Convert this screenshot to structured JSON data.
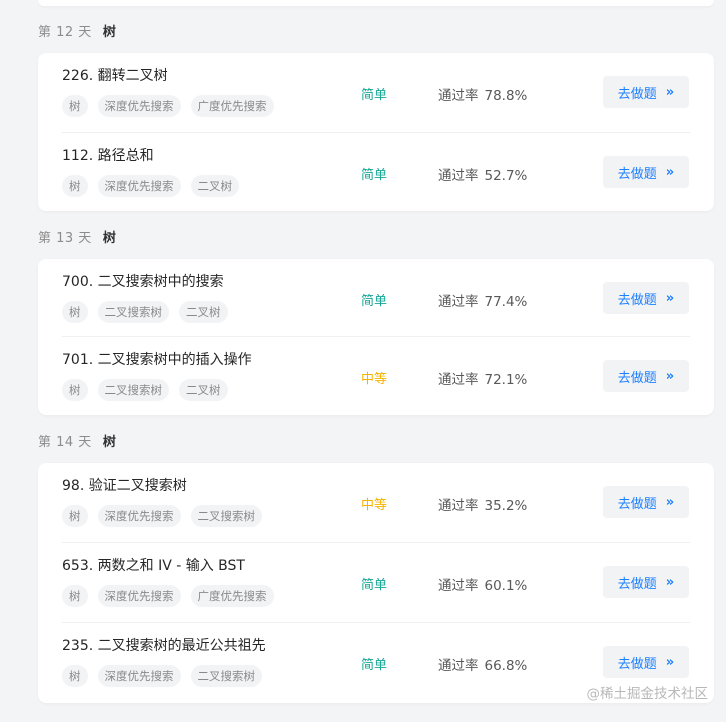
{
  "days": [
    {
      "day_label": "第 12 天",
      "topic": "树",
      "problems": [
        {
          "title": "226. 翻转二叉树",
          "tags": [
            "树",
            "深度优先搜索",
            "广度优先搜索"
          ],
          "difficulty": "简单",
          "difficulty_level": "easy",
          "rate_label": "通过率",
          "rate": "78.8%",
          "button_label": "去做题"
        },
        {
          "title": "112. 路径总和",
          "tags": [
            "树",
            "深度优先搜索",
            "二叉树"
          ],
          "difficulty": "简单",
          "difficulty_level": "easy",
          "rate_label": "通过率",
          "rate": "52.7%",
          "button_label": "去做题"
        }
      ]
    },
    {
      "day_label": "第 13 天",
      "topic": "树",
      "problems": [
        {
          "title": "700. 二叉搜索树中的搜索",
          "tags": [
            "树",
            "二叉搜索树",
            "二叉树"
          ],
          "difficulty": "简单",
          "difficulty_level": "easy",
          "rate_label": "通过率",
          "rate": "77.4%",
          "button_label": "去做题"
        },
        {
          "title": "701. 二叉搜索树中的插入操作",
          "tags": [
            "树",
            "二叉搜索树",
            "二叉树"
          ],
          "difficulty": "中等",
          "difficulty_level": "medium",
          "rate_label": "通过率",
          "rate": "72.1%",
          "button_label": "去做题"
        }
      ]
    },
    {
      "day_label": "第 14 天",
      "topic": "树",
      "problems": [
        {
          "title": "98. 验证二叉搜索树",
          "tags": [
            "树",
            "深度优先搜索",
            "二叉搜索树"
          ],
          "difficulty": "中等",
          "difficulty_level": "medium",
          "rate_label": "通过率",
          "rate": "35.2%",
          "button_label": "去做题"
        },
        {
          "title": "653. 两数之和 IV - 输入 BST",
          "tags": [
            "树",
            "深度优先搜索",
            "广度优先搜索"
          ],
          "difficulty": "简单",
          "difficulty_level": "easy",
          "rate_label": "通过率",
          "rate": "60.1%",
          "button_label": "去做题"
        },
        {
          "title": "235. 二叉搜索树的最近公共祖先",
          "tags": [
            "树",
            "深度优先搜索",
            "二叉搜索树"
          ],
          "difficulty": "简单",
          "difficulty_level": "easy",
          "rate_label": "通过率",
          "rate": "66.8%",
          "button_label": "去做题"
        }
      ]
    }
  ],
  "button_icon": "double-chevron-right-icon",
  "watermark": "@稀土掘金技术社区",
  "colors": {
    "easy": "#16a596",
    "medium": "#f5b300",
    "link": "#1e80ff",
    "page_bg": "#f3f4f6"
  }
}
